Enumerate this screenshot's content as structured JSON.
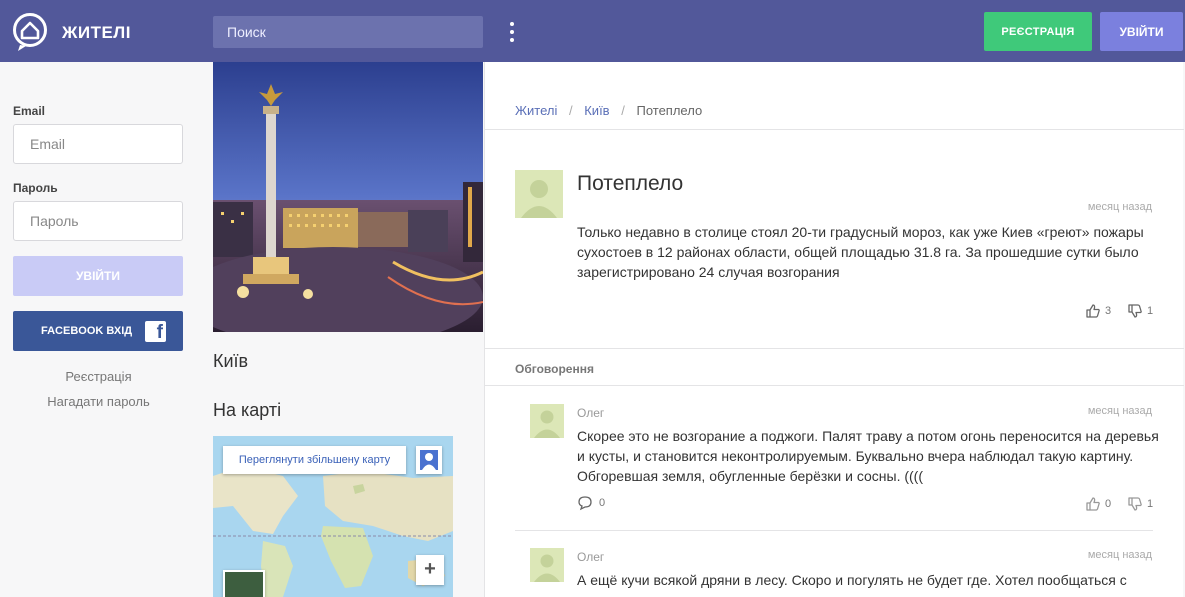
{
  "header": {
    "brand": "ЖИТЕЛІ",
    "search_placeholder": "Поиск",
    "register_label": "РЕЄСТРАЦІЯ",
    "login_label": "УВІЙТИ"
  },
  "sidebar": {
    "email_label": "Email",
    "email_placeholder": "Email",
    "password_label": "Пароль",
    "password_placeholder": "Пароль",
    "login_label": "УВІЙТИ",
    "facebook_label": "FACEBOOK ВХІД",
    "facebook_glyph": "f",
    "register_link": "Реєстрація",
    "forgot_link": "Нагадати пароль"
  },
  "city": {
    "name": "Київ",
    "map_heading": "На карті",
    "map_button": "Переглянути збільшену карту",
    "zoom_in": "+"
  },
  "breadcrumb": {
    "items": [
      "Жителі",
      "Київ",
      "Потеплело"
    ],
    "separator": "/"
  },
  "post": {
    "title": "Потеплело",
    "time": "месяц назад",
    "body": "Только недавно в столице стоял 20-ти градусный мороз, как уже Киев «греют» пожары сухостоев в 12 районах области, общей площадью 31.8 га. За прошедшие сутки было зарегистрировано 24 случая возгорания",
    "likes": "3",
    "dislikes": "1"
  },
  "discussion": {
    "label": "Обговорення",
    "comments": [
      {
        "author": "Олег",
        "time": "месяц назад",
        "text": "Скорее это не возгорание а поджоги. Палят траву а потом огонь переносится на деревья и кусты, и становится неконтролируемым. Буквально вчера наблюдал такую картину. Обгоревшая земля, обугленные берёзки и сосны. ((((",
        "replies": "0",
        "likes": "0",
        "dislikes": "1"
      },
      {
        "author": "Олег",
        "time": "месяц назад",
        "text": "А ещё кучи всякой дряни в лесу. Скоро и погулять не будет где. Хотел пообщаться с"
      }
    ]
  },
  "colors": {
    "header_bg": "#52589a",
    "register_bg": "#3fc97a",
    "login_bg": "#7b80de",
    "facebook_bg": "#3a5798",
    "link": "#5a6fb7"
  }
}
